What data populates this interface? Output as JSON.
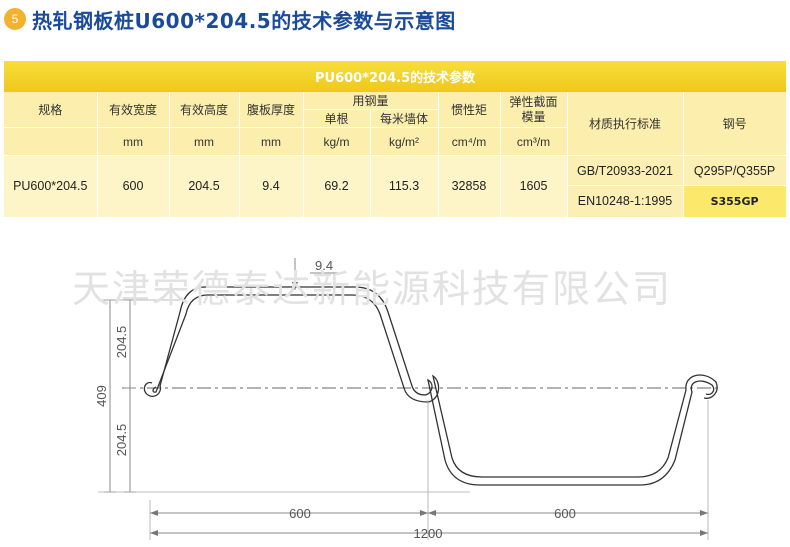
{
  "header": {
    "number": "5",
    "title": "热轧钢板桩U600*204.5的技术参数与示意图"
  },
  "table": {
    "title": "PU600*204.5的技术参数",
    "headers": {
      "spec": "规格",
      "width": "有效宽度",
      "height": "有效高度",
      "web": "腹板厚度",
      "steel_use": "用钢量",
      "single": "单根",
      "per_m2": "每米墙体",
      "inertia": "惯性矩",
      "modulus_line1": "弹性截面",
      "modulus_line2": "模量",
      "standard": "材质执行标准",
      "grade": "钢号"
    },
    "units": {
      "width": "mm",
      "height": "mm",
      "web": "mm",
      "single": "kg/m",
      "per_m2": "kg/m²",
      "inertia": "cm⁴/m",
      "modulus": "cm³/m"
    },
    "row": {
      "spec": "PU600*204.5",
      "width": "600",
      "height": "204.5",
      "web": "9.4",
      "single": "69.2",
      "per_m2": "115.3",
      "inertia": "32858",
      "modulus": "1605",
      "standard1": "GB/T20933-2021",
      "grade1": "Q295P/Q355P",
      "standard2": "EN10248-1:1995",
      "grade2": "S355GP"
    }
  },
  "watermark": "天津荣德泰达新能源科技有限公司",
  "drawing": {
    "thickness": "9.4",
    "half_height_upper": "204.5",
    "half_height_lower": "204.5",
    "total_height": "409",
    "left_width": "600",
    "right_width": "600",
    "total_width": "1200"
  }
}
